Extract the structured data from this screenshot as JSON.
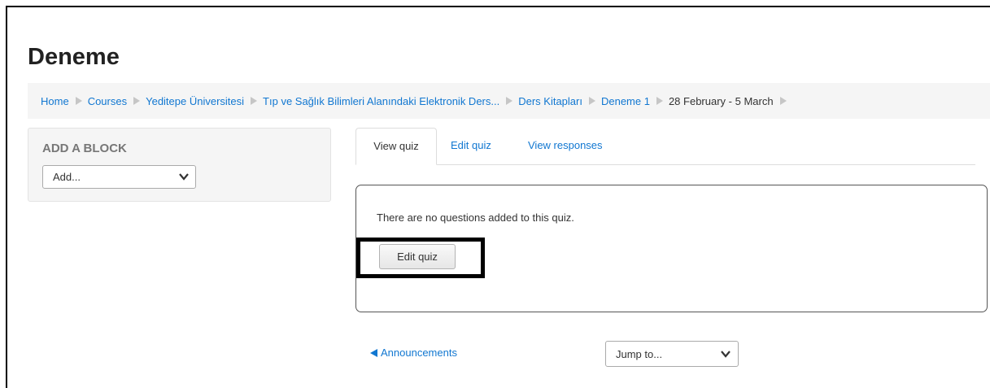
{
  "page": {
    "title": "Deneme"
  },
  "breadcrumb": {
    "items": [
      "Home",
      "Courses",
      "Yeditepe Üniversitesi",
      "Tıp ve Sağlık Bilimleri Alanındaki Elektronik Ders...",
      "Ders Kitapları",
      "Deneme 1",
      "28 February - 5 March"
    ],
    "separator_icon": "triangle-right-icon"
  },
  "block": {
    "title": "ADD A BLOCK",
    "select_value": "Add...",
    "chevron_icon": "chevron-down-icon"
  },
  "tabs": [
    {
      "label": "View quiz",
      "active": true
    },
    {
      "label": "Edit quiz",
      "active": false
    },
    {
      "label": "View responses",
      "active": false
    }
  ],
  "quiz": {
    "message": "There are no questions added to this quiz.",
    "edit_button_label": "Edit quiz"
  },
  "navigation": {
    "prev_label": "Announcements",
    "prev_icon": "triangle-left-icon",
    "jump_select_value": "Jump to...",
    "jump_chevron_icon": "chevron-down-icon"
  },
  "colors": {
    "link": "#1177d1",
    "breadcrumb_bg": "#f5f5f5",
    "highlight_border": "#000000"
  }
}
